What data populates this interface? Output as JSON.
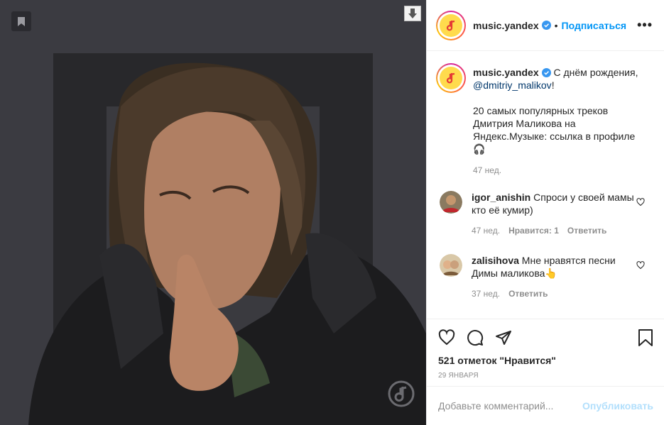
{
  "media": {
    "bookmark_icon": "bookmark-icon",
    "download_icon": "download-arrow-icon",
    "watermark_icon": "yandex-music-logo"
  },
  "header": {
    "username": "music.yandex",
    "separator": "•",
    "follow_label": "Подписаться",
    "more_label": "•••"
  },
  "caption": {
    "username": "music.yandex",
    "text_line1": " С днём рождения, ",
    "mention": "@dmitriy_malikov",
    "text_after_mention": "!",
    "text_block": "20 самых популярных треков Дмитрия Маликова на Яндекс.Музыке: ссылка в профиле 🎧",
    "time": "47 нед."
  },
  "comments": [
    {
      "username": "igor_anishin",
      "text": " Спроси у своей мамы кто её кумир)",
      "time": "47 нед.",
      "likes": "Нравится: 1",
      "reply": "Ответить"
    },
    {
      "username": "zalisihova",
      "text": " Мне нравятся песни Димы маликова👆",
      "time": "37 нед.",
      "reply": "Ответить"
    }
  ],
  "actions": {
    "likes_count": "521 отметок \"Нравится\"",
    "date": "29 января"
  },
  "add_comment": {
    "placeholder": "Добавьте комментарий...",
    "publish_label": "Опубликовать"
  },
  "colors": {
    "accent": "#0095f6",
    "publish_disabled": "#b2dffc",
    "media_bg": "#3b3b41",
    "brand_yellow": "#ffdb4d"
  }
}
